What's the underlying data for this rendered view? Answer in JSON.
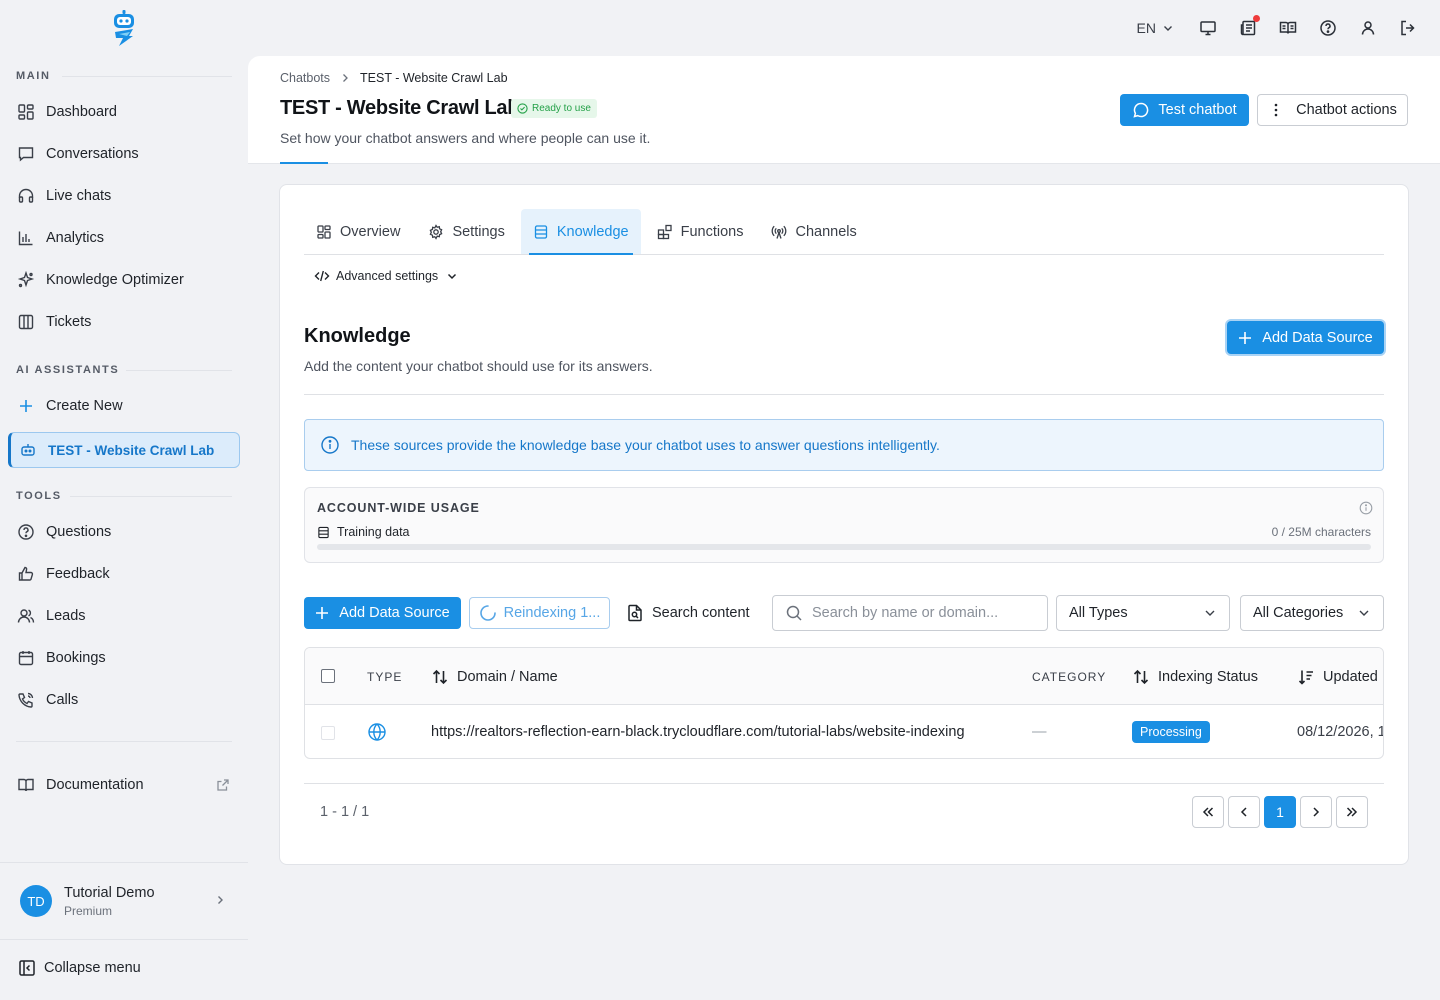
{
  "colors": {
    "accent": "#1a8fe3",
    "success": "#24a148",
    "notification": "#ef3b3b"
  },
  "topbar": {
    "language": "EN"
  },
  "sidebar": {
    "main_label": "MAIN",
    "main_items": [
      {
        "label": "Dashboard",
        "icon": "dashboard-icon"
      },
      {
        "label": "Conversations",
        "icon": "chat-icon"
      },
      {
        "label": "Live chats",
        "icon": "headset-icon"
      },
      {
        "label": "Analytics",
        "icon": "bar-chart-icon"
      },
      {
        "label": "Knowledge Optimizer",
        "icon": "sparkle-icon"
      },
      {
        "label": "Tickets",
        "icon": "columns-icon"
      }
    ],
    "assistants_label": "AI ASSISTANTS",
    "create_new": "Create New",
    "active_assistant": "TEST - Website Crawl Lab",
    "tools_label": "TOOLS",
    "tools_items": [
      {
        "label": "Questions",
        "icon": "question-icon"
      },
      {
        "label": "Feedback",
        "icon": "thumbs-up-icon"
      },
      {
        "label": "Leads",
        "icon": "users-icon"
      },
      {
        "label": "Bookings",
        "icon": "calendar-icon"
      },
      {
        "label": "Calls",
        "icon": "phone-icon"
      }
    ],
    "documentation": "Documentation",
    "user": {
      "initials": "TD",
      "name": "Tutorial Demo",
      "plan": "Premium"
    },
    "collapse": "Collapse menu"
  },
  "header": {
    "breadcrumb": [
      "Chatbots",
      "TEST - Website Crawl Lab"
    ],
    "title": "TEST - Website Crawl Lab",
    "status": "Ready to use",
    "subtitle": "Set how your chatbot answers and where people can use it.",
    "test_button": "Test chatbot",
    "actions_button": "Chatbot actions"
  },
  "tabs": [
    {
      "label": "Overview",
      "icon": "grid-icon"
    },
    {
      "label": "Settings",
      "icon": "gear-icon"
    },
    {
      "label": "Knowledge",
      "icon": "database-icon"
    },
    {
      "label": "Functions",
      "icon": "blocks-icon"
    },
    {
      "label": "Channels",
      "icon": "broadcast-icon"
    }
  ],
  "advanced_settings": "Advanced settings",
  "knowledge": {
    "title": "Knowledge",
    "subtitle": "Add the content your chatbot should use for its answers.",
    "add_button": "Add Data Source",
    "info": "These sources provide the knowledge base your chatbot uses to answer questions intelligently."
  },
  "usage": {
    "title": "ACCOUNT-WIDE USAGE",
    "label": "Training data",
    "value": "0 / 25M characters",
    "fraction": 0
  },
  "toolbar": {
    "add_button": "Add Data Source",
    "reindex_button": "Reindexing 1...",
    "search_content": "Search content",
    "search_placeholder": "Search by name or domain...",
    "type_filter": "All Types",
    "category_filter": "All Categories"
  },
  "table": {
    "columns": [
      "TYPE",
      "Domain / Name",
      "CATEGORY",
      "Indexing Status",
      "Updated"
    ],
    "rows": [
      {
        "type_icon": "globe-icon",
        "name": "https://realtors-reflection-earn-black.trycloudflare.com/tutorial-labs/website-indexing",
        "category": "—",
        "status": "Processing",
        "updated": "08/12/2026, 1"
      }
    ]
  },
  "pagination": {
    "range": "1 - 1 / 1",
    "current_page": "1"
  }
}
